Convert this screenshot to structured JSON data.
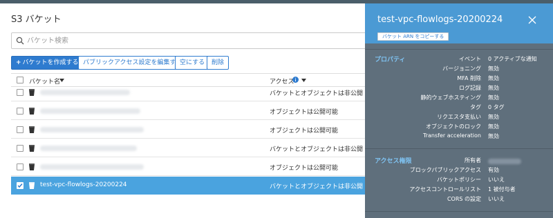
{
  "header": {
    "title": "S3 バケット"
  },
  "search": {
    "placeholder": "バケット検索"
  },
  "toolbar": {
    "create_label": "バケットを作成する",
    "create_plus": "+",
    "edit_public_label": "パブリックアクセス設定を編集する",
    "empty_label": "空にする",
    "delete_label": "削除"
  },
  "table": {
    "col_name": "バケット名",
    "col_access": "アクセス",
    "rows": [
      {
        "name": "",
        "access": "バケットとオブジェクトは非公開",
        "selected": false
      },
      {
        "name": "",
        "access": "オブジェクトは公開可能",
        "selected": false
      },
      {
        "name": "",
        "access": "オブジェクトは公開可能",
        "selected": false
      },
      {
        "name": "",
        "access": "バケットとオブジェクトは非公開",
        "selected": false
      },
      {
        "name": "",
        "access": "オブジェクトは公開可能",
        "selected": false
      },
      {
        "name": "test-vpc-flowlogs-20200224",
        "access": "バケットとオブジェクトは非公開",
        "selected": true
      }
    ]
  },
  "panel": {
    "title": "test-vpc-flowlogs-20200224",
    "copy_arn_label": "バケット ARN をコピーする",
    "properties_label": "プロパティ",
    "properties": [
      {
        "key": "イベント",
        "value": "0 アクティブな通知"
      },
      {
        "key": "バージョニング",
        "value": "無効"
      },
      {
        "key": "MFA 削除",
        "value": "無効"
      },
      {
        "key": "ログ記録",
        "value": "無効"
      },
      {
        "key": "静的ウェブホスティング",
        "value": "無効"
      },
      {
        "key": "タグ",
        "value": "0 タグ"
      },
      {
        "key": "リクエスタ支払い",
        "value": "無効"
      },
      {
        "key": "オブジェクトのロック",
        "value": "無効"
      },
      {
        "key": "Transfer acceleration",
        "value": "無効"
      }
    ],
    "access_label": "アクセス権限",
    "access": [
      {
        "key": "所有者",
        "value": ""
      },
      {
        "key": "ブロックパブリックアクセス",
        "value": "有効"
      },
      {
        "key": "バケットポリシー",
        "value": "いいえ"
      },
      {
        "key": "アクセスコントロールリスト",
        "value": "1 被付与者"
      },
      {
        "key": "CORS の設定",
        "value": "いいえ"
      }
    ]
  },
  "colors": {
    "topbar": "#4a5e6a",
    "primary": "#2e7bcf",
    "selected_row": "#4aa3df",
    "panel_bg": "#5f6f7c",
    "panel_head": "#4b9ad4",
    "section_label": "#7fc3f2"
  },
  "icons": {
    "search": "search-icon",
    "bucket": "bucket-icon",
    "info": "info-icon",
    "sort": "sort-down-icon",
    "close": "close-icon",
    "checkbox": "checkbox-icon"
  }
}
